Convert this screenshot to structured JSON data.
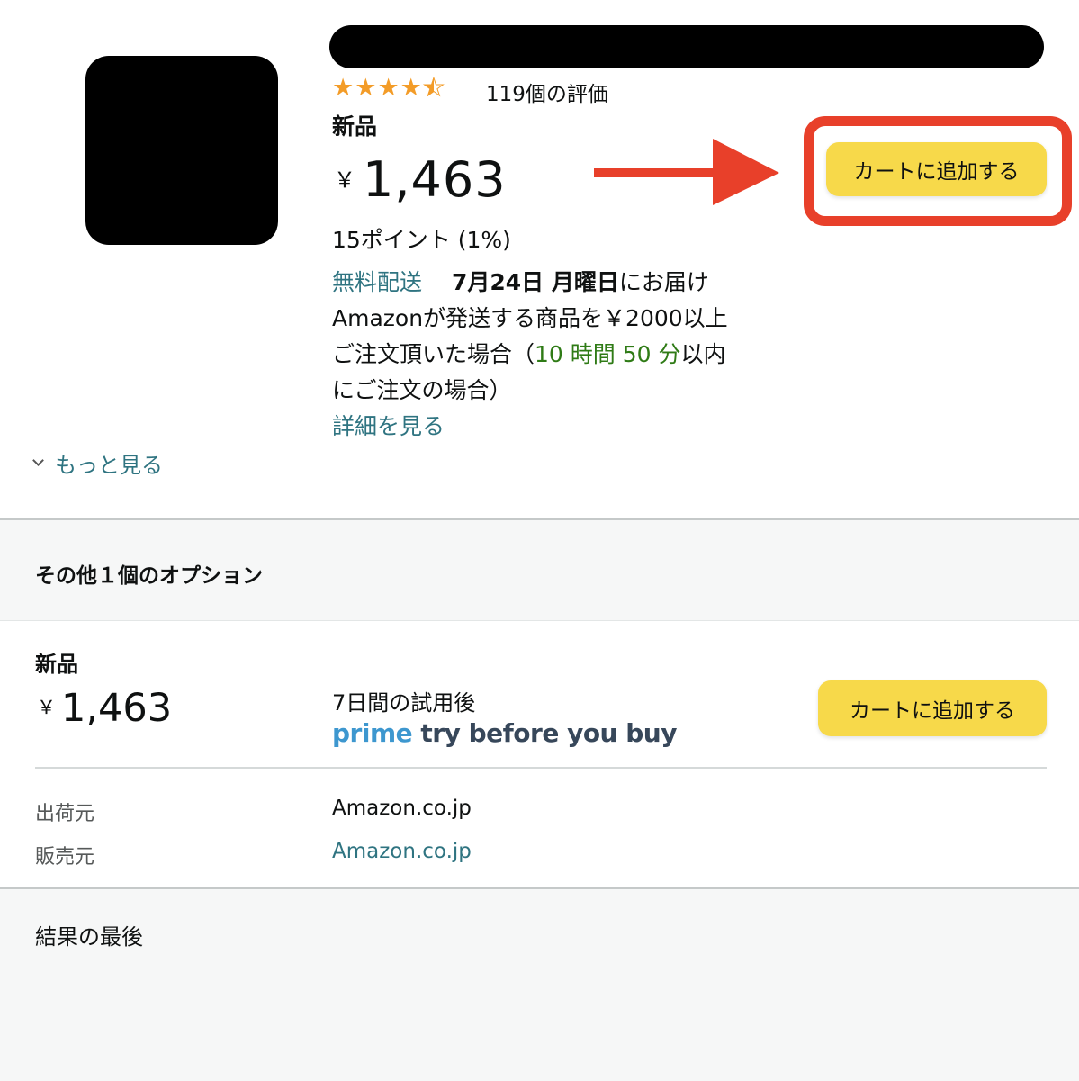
{
  "product": {
    "rating": 4.5,
    "rating_count_label": "119個の評価",
    "condition": "新品",
    "currency": "￥",
    "price": "1,463",
    "points": "15ポイント (1%)",
    "delivery": {
      "free_label": "無料配送",
      "date": "7月24日 月曜日",
      "line_a": "にお届け　Amazonが発送する商品を￥2000以上ご注文頂いた場合（",
      "countdown": "10 時間 50 分",
      "line_b": "以内にご注文の場合）",
      "details_link": "詳細を見る"
    },
    "add_to_cart_label": "カートに追加する"
  },
  "more_link_label": "もっと見る",
  "options": {
    "title": "その他１個のオプション",
    "offer": {
      "condition": "新品",
      "currency": "￥",
      "price": "1,463",
      "trial_label": "7日間の試用後",
      "prime_word": "prime",
      "prime_tagline": "try before you buy",
      "add_to_cart_label": "カートに追加する",
      "ships_from_label": "出荷元",
      "ships_from_value": "Amazon.co.jp",
      "sold_by_label": "販売元",
      "sold_by_value": "Amazon.co.jp"
    }
  },
  "footer": {
    "end_text": "結果の最後"
  },
  "annotation": {
    "color": "#e8402a"
  },
  "colors": {
    "button": "#f7d94a",
    "link": "#2f7481",
    "countdown": "#2f7b16",
    "star": "#f39c28",
    "prime": "#3d97cf"
  }
}
